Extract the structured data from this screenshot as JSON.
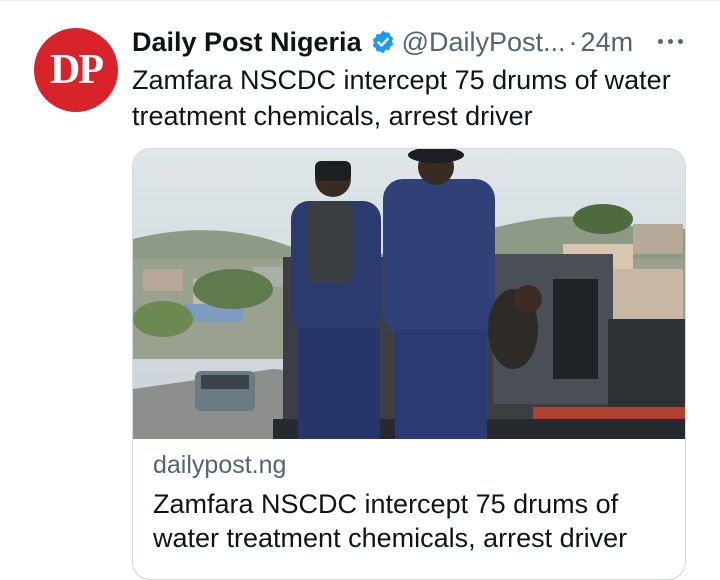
{
  "tweet": {
    "avatar_text": "DP",
    "author_name": "Daily Post Nigeria",
    "handle": "@DailyPost...",
    "separator": "·",
    "time": "24m",
    "text": "Zamfara NSCDC intercept 75 drums of water treatment chemicals, arrest driver",
    "verified_icon": "verified-badge-icon",
    "more_icon": "more-options-icon"
  },
  "card": {
    "domain": "dailypost.ng",
    "title": "Zamfara NSCDC intercept 75 drums of water treatment chemicals, arrest driver"
  },
  "colors": {
    "avatar_bg": "#d8232a",
    "verified_blue": "#1d9bf0",
    "secondary_text": "#536471",
    "uniform_navy": "#2c3b6e"
  }
}
